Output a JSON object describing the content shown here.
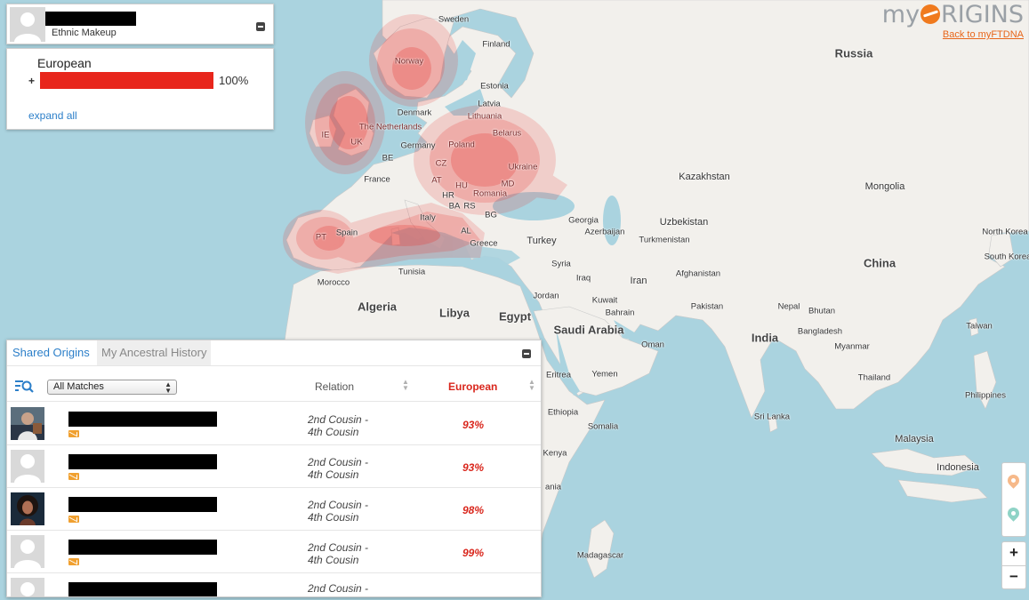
{
  "logo": {
    "brand_left": "my",
    "brand_right": "RIGINS",
    "back_link": "Back to myFTDNA"
  },
  "user_card": {
    "subtitle": "Ethnic Makeup"
  },
  "ethnic_makeup": {
    "region": "European",
    "percent_label": "100%",
    "percent": 100,
    "expand_label": "expand all"
  },
  "matches": {
    "tabs": [
      "Shared Origins",
      "My Ancestral History"
    ],
    "filter": {
      "selected": "All Matches"
    },
    "columns": {
      "relation": "Relation",
      "european": "European"
    },
    "rows": [
      {
        "relation_line1": "2nd Cousin -",
        "relation_line2": "4th Cousin",
        "european": "93%",
        "photo": "photo"
      },
      {
        "relation_line1": "2nd Cousin -",
        "relation_line2": "4th Cousin",
        "european": "93%",
        "photo": "default"
      },
      {
        "relation_line1": "2nd Cousin -",
        "relation_line2": "4th Cousin",
        "european": "98%",
        "photo": "photo"
      },
      {
        "relation_line1": "2nd Cousin -",
        "relation_line2": "4th Cousin",
        "european": "99%",
        "photo": "default"
      },
      {
        "relation_line1": "2nd Cousin -",
        "relation_line2": "",
        "european": "",
        "photo": "default"
      }
    ]
  },
  "map": {
    "labels": {
      "sweden": "Sweden",
      "finland": "Finland",
      "norway": "Norway",
      "russia": "Russia",
      "estonia": "Estonia",
      "latvia": "Latvia",
      "lithuania": "Lithuania",
      "denmark": "Denmark",
      "ie": "IE",
      "uk": "UK",
      "netherlands": "The Netherlands",
      "germany": "Germany",
      "poland": "Poland",
      "belarus": "Belarus",
      "be": "BE",
      "cz": "CZ",
      "ukraine": "Ukraine",
      "france": "France",
      "at": "AT",
      "hu": "HU",
      "md": "MD",
      "romania": "Romania",
      "hr": "HR",
      "ba": "BA",
      "rs": "RS",
      "bg": "BG",
      "italy": "Italy",
      "spain": "Spain",
      "pt": "PT",
      "al": "AL",
      "greece": "Greece",
      "georgia": "Georgia",
      "azerbaijan": "Azerbaijan",
      "turkey": "Turkey",
      "kazakhstan": "Kazakhstan",
      "uzbekistan": "Uzbekistan",
      "turkmenistan": "Turkmenistan",
      "mongolia": "Mongolia",
      "china": "China",
      "north_korea": "North Korea",
      "south_korea": "South Korea",
      "syria": "Syria",
      "iraq": "Iraq",
      "iran": "Iran",
      "afghanistan": "Afghanistan",
      "tunisia": "Tunisia",
      "morocco": "Morocco",
      "algeria": "Algeria",
      "libya": "Libya",
      "egypt": "Egypt",
      "jordan": "Jordan",
      "kuwait": "Kuwait",
      "bahrain": "Bahrain",
      "pakistan": "Pakistan",
      "nepal": "Nepal",
      "bhutan": "Bhutan",
      "saudi_arabia": "Saudi Arabia",
      "oman": "Oman",
      "india": "India",
      "bangladesh": "Bangladesh",
      "myanmar": "Myanmar",
      "taiwan": "Taiwan",
      "eritrea": "Eritrea",
      "yemen": "Yemen",
      "thailand": "Thailand",
      "philippines": "Philippines",
      "ethiopia": "Ethiopia",
      "sri_lanka": "Sri Lanka",
      "somalia": "Somalia",
      "malaysia": "Malaysia",
      "kenya": "Kenya",
      "indonesia": "Indonesia",
      "madagascar": "Madagascar",
      "tanzania": "ania"
    }
  },
  "controls": {
    "zoom_in": "+",
    "zoom_out": "−"
  },
  "colors": {
    "accent": "#2c7fc9",
    "bar": "#e8261c",
    "brand_orange": "#f07a1e",
    "pin_orange": "#f6b98a",
    "pin_teal": "#8fd3c6"
  }
}
